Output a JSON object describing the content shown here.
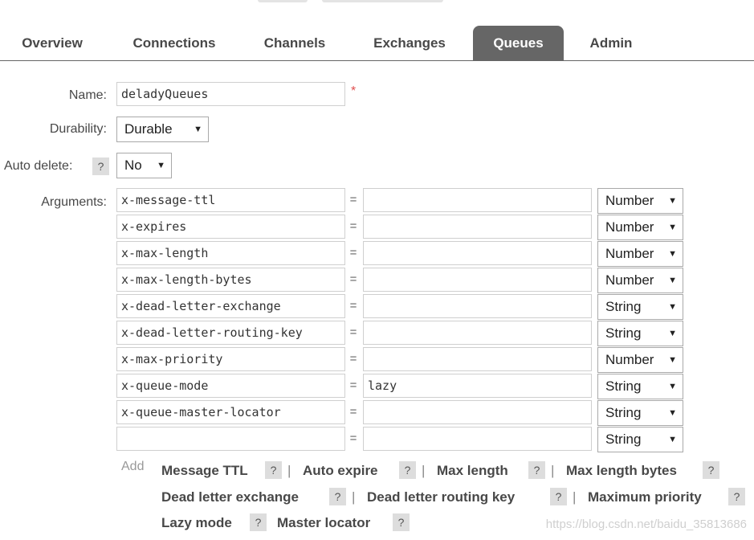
{
  "nav": {
    "tabs": [
      {
        "label": "Overview"
      },
      {
        "label": "Connections"
      },
      {
        "label": "Channels"
      },
      {
        "label": "Exchanges"
      },
      {
        "label": "Queues",
        "active": true
      },
      {
        "label": "Admin"
      }
    ]
  },
  "form": {
    "name_label": "Name:",
    "name_value": "deladyQueues",
    "required_mark": "*",
    "durability_label": "Durability:",
    "durability_value": "Durable",
    "auto_delete_label": "Auto delete:",
    "auto_delete_value": "No",
    "help_mark": "?",
    "arguments_label": "Arguments:",
    "equals": "="
  },
  "arguments": [
    {
      "key": "x-message-ttl",
      "value": "",
      "type": "Number"
    },
    {
      "key": "x-expires",
      "value": "",
      "type": "Number"
    },
    {
      "key": "x-max-length",
      "value": "",
      "type": "Number"
    },
    {
      "key": "x-max-length-bytes",
      "value": "",
      "type": "Number"
    },
    {
      "key": "x-dead-letter-exchange",
      "value": "",
      "type": "String"
    },
    {
      "key": "x-dead-letter-routing-key",
      "value": "",
      "type": "String"
    },
    {
      "key": "x-max-priority",
      "value": "",
      "type": "Number"
    },
    {
      "key": "x-queue-mode",
      "value": "lazy",
      "type": "String"
    },
    {
      "key": "x-queue-master-locator",
      "value": "",
      "type": "String"
    },
    {
      "key": "",
      "value": "",
      "type": "String"
    }
  ],
  "add_label": "Add",
  "shortcuts": [
    "Message TTL",
    "Auto expire",
    "Max length",
    "Max length bytes",
    "Dead letter exchange",
    "Dead letter routing key",
    "Maximum priority",
    "Lazy mode",
    "Master locator"
  ],
  "separator": "|",
  "watermark": "https://blog.csdn.net/baidu_35813686",
  "colors": {
    "active_tab": "#666666",
    "help_bg": "#dddddd",
    "required": "#e05050"
  }
}
